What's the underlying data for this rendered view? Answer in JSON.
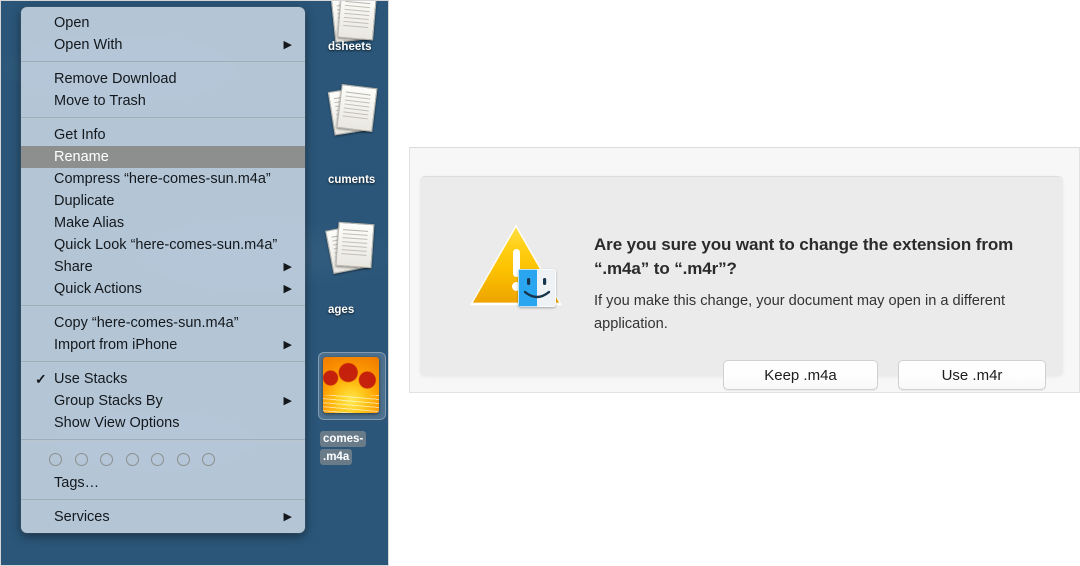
{
  "desktop": {
    "wallpaper_description": "ocean-water-wallpaper",
    "accent_highlight": "#8d8e8e",
    "menu_background": "#becfde",
    "stacks": [
      {
        "name": "spreadsheets-stack",
        "label": "dsheets",
        "icon": "paper-stack-icon"
      },
      {
        "name": "documents-stack",
        "label": "cuments",
        "icon": "paper-stack-icon"
      },
      {
        "name": "images-stack",
        "label": "ages",
        "icon": "photo-stack-icon"
      }
    ],
    "selected_file": {
      "name": "here-comes-sun-file",
      "label_line1": "comes-",
      "label_line2": ".m4a",
      "icon": "album-art-icon"
    }
  },
  "context_menu": {
    "groups": [
      {
        "items": [
          {
            "label": "Open",
            "submenu": false,
            "checked": false,
            "selected": false
          },
          {
            "label": "Open With",
            "submenu": true,
            "checked": false,
            "selected": false
          }
        ]
      },
      {
        "items": [
          {
            "label": "Remove Download",
            "submenu": false,
            "checked": false,
            "selected": false
          },
          {
            "label": "Move to Trash",
            "submenu": false,
            "checked": false,
            "selected": false
          }
        ]
      },
      {
        "items": [
          {
            "label": "Get Info",
            "submenu": false,
            "checked": false,
            "selected": false
          },
          {
            "label": "Rename",
            "submenu": false,
            "checked": false,
            "selected": true
          },
          {
            "label": "Compress “here-comes-sun.m4a”",
            "submenu": false,
            "checked": false,
            "selected": false
          },
          {
            "label": "Duplicate",
            "submenu": false,
            "checked": false,
            "selected": false
          },
          {
            "label": "Make Alias",
            "submenu": false,
            "checked": false,
            "selected": false
          },
          {
            "label": "Quick Look “here-comes-sun.m4a”",
            "submenu": false,
            "checked": false,
            "selected": false
          },
          {
            "label": "Share",
            "submenu": true,
            "checked": false,
            "selected": false
          },
          {
            "label": "Quick Actions",
            "submenu": true,
            "checked": false,
            "selected": false
          }
        ]
      },
      {
        "items": [
          {
            "label": "Copy “here-comes-sun.m4a”",
            "submenu": false,
            "checked": false,
            "selected": false
          },
          {
            "label": "Import from iPhone",
            "submenu": true,
            "checked": false,
            "selected": false
          }
        ]
      },
      {
        "items": [
          {
            "label": "Use Stacks",
            "submenu": false,
            "checked": true,
            "selected": false
          },
          {
            "label": "Group Stacks By",
            "submenu": true,
            "checked": false,
            "selected": false
          },
          {
            "label": "Show View Options",
            "submenu": false,
            "checked": false,
            "selected": false
          }
        ]
      },
      {
        "tags": {
          "count": 7,
          "label": "Tags…"
        },
        "items": []
      },
      {
        "items": [
          {
            "label": "Services",
            "submenu": true,
            "checked": false,
            "selected": false
          }
        ]
      }
    ],
    "submenu_glyph": "▶",
    "check_glyph": "✓"
  },
  "dialog": {
    "icon_name": "warning-triangle-with-finder-badge",
    "title": "Are you sure you want to change the extension from “.m4a” to “.m4r”?",
    "body": "If you make this change, your document may open in a different application.",
    "buttons": [
      {
        "name": "keep-extension-button",
        "label": "Keep .m4a"
      },
      {
        "name": "use-extension-button",
        "label": "Use .m4r"
      }
    ],
    "warning_color": "#fcc200",
    "panel_color": "#ebebeb"
  }
}
